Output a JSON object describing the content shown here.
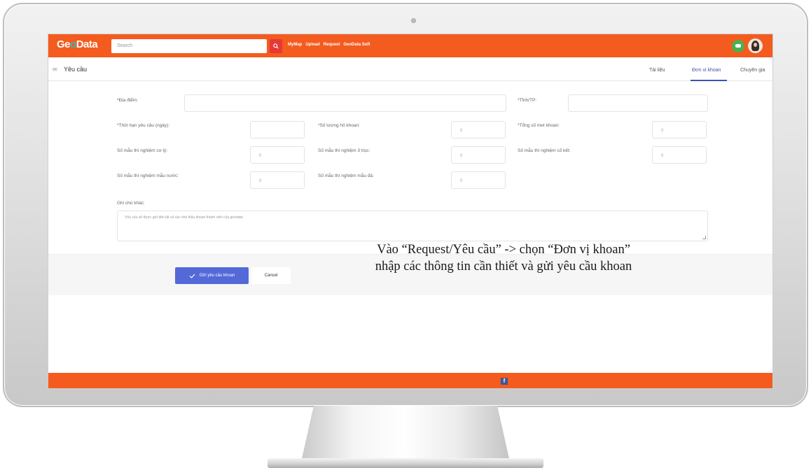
{
  "nav": {
    "logo_a": "Ge",
    "logo_o": "o",
    "logo_b": "Data",
    "search_placeholder": "Search",
    "links": [
      "MyMap",
      "Upload",
      "Request",
      "GeoData Soft"
    ]
  },
  "subheader": {
    "title": "Yêu cầu",
    "tabs": [
      "Tài liệu",
      "Đơn vị khoan",
      "Chuyên gia"
    ],
    "active_tab": "Đơn vị khoan"
  },
  "form": {
    "dia_diem_label": "*Địa điểm:",
    "tinh_label": "*Tỉnh/TP:",
    "thoi_han_label": "*Thời hạn yêu cầu (ngày):",
    "so_luong_label": "*Số lượng hố khoan:",
    "so_luong_value": "0",
    "tong_so_met_label": "*Tổng số met khoan:",
    "tong_so_met_value": "0",
    "co_ly_label": "Số mẫu thí nghiệm cơ lý:",
    "co_ly_value": "0",
    "ba_truc_label": "Số mẫu thí nghiệm 3 trục:",
    "ba_truc_value": "0",
    "co_ket_label": "Số mẫu thí nghiệm cố kết:",
    "co_ket_value": "0",
    "mau_nuoc_label": "Số mẫu thí nghiệm mẫu nước:",
    "mau_nuoc_value": "0",
    "mau_da_label": "Số mẫu thí nghiệm mẫu đá:",
    "mau_da_value": "0",
    "ghi_chu_label": "Ghi chú khác:",
    "ghi_chu_text": "Yêu cầu sẽ được gửi đến tất cả các nhà thầu khoan thành viên của geodata"
  },
  "actions": {
    "send_label": "Gửi yêu cầu khoan",
    "cancel_label": "Cancel"
  },
  "caption": {
    "line1": "Vào “Request/Yêu cầu” -> chọn “Đơn vị khoan”",
    "line2": "nhập các thông tin cần thiết và gửi yêu cầu khoan"
  },
  "colors": {
    "brand_orange": "#f45b1e",
    "accent_blue": "#5369d8"
  }
}
